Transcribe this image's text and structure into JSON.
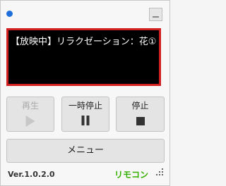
{
  "player": {
    "status_text": "【放映中】リラクゼーション：花①"
  },
  "controls": {
    "play_label": "再生",
    "pause_label": "一時停止",
    "stop_label": "停止"
  },
  "menu": {
    "label": "メニュー"
  },
  "footer": {
    "version": "Ver.1.0.2.0",
    "brand": "リモコン"
  },
  "colors": {
    "accent_dot": "#1e6fd9",
    "screen_border": "#d21f1f",
    "brand_green": "#34b000"
  }
}
